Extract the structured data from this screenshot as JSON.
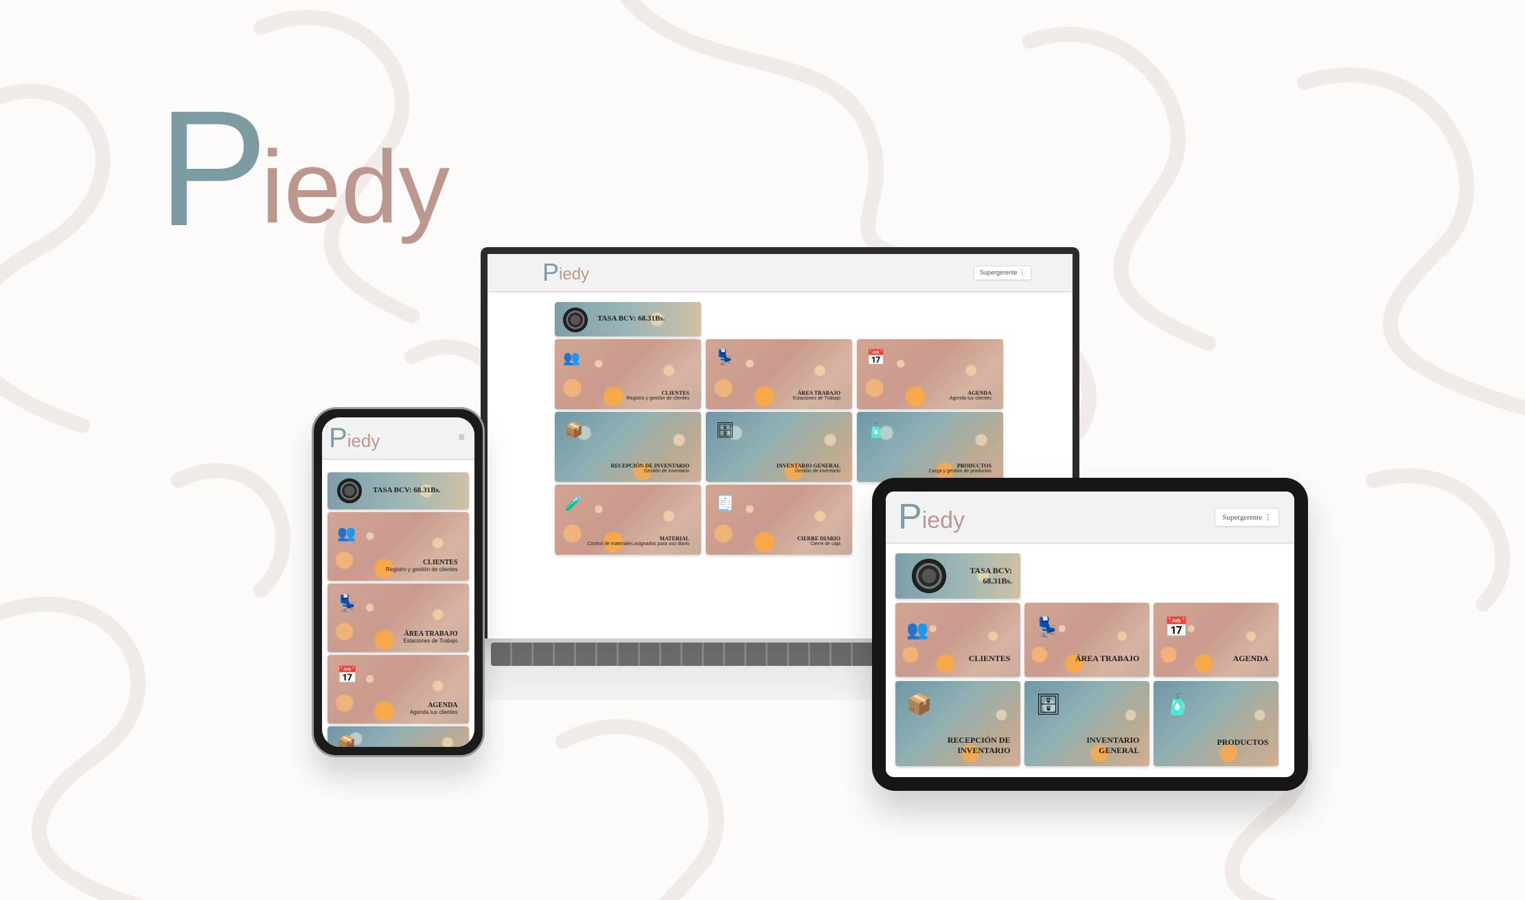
{
  "brand": {
    "logo_p": "P",
    "logo_rest": "iedy",
    "p_color": "#7c9ba3",
    "rest_color": "#bb978d"
  },
  "user_menu": {
    "label": "Supergerente",
    "icon": "kebab-menu-icon"
  },
  "rate": {
    "label": "TASA BCV: 68.31Bs.",
    "label_line1": "TASA BCV:",
    "label_line2": "68.31Bs.",
    "seal_text": "BCV"
  },
  "modules": [
    {
      "title": "CLIENTES",
      "subtitle": "Registro y gestión de clientes",
      "icon": "clients-icon"
    },
    {
      "title": "ÁREA TRABAJO",
      "subtitle": "Estaciones de Trabajo",
      "icon": "workstation-icon"
    },
    {
      "title": "AGENDA",
      "subtitle": "Agenda tus clientes",
      "icon": "calendar-icon"
    },
    {
      "title": "RECEPCIÓN DE INVENTARIO",
      "title_line1": "RECEPCIÓN DE",
      "title_line2": "INVENTARIO",
      "subtitle": "Gestión de inventario",
      "icon": "boxes-icon"
    },
    {
      "title": "INVENTARIO GENERAL",
      "title_line1": "INVENTARIO",
      "title_line2": "GENERAL",
      "subtitle": "Gestión de inventario",
      "icon": "shelves-icon"
    },
    {
      "title": "PRODUCTOS",
      "subtitle": "Carga y gestión de productos",
      "icon": "bottles-icon"
    },
    {
      "title": "MATERIAL",
      "subtitle": "Control de materiales asignados para uso diario",
      "icon": "materials-icon"
    },
    {
      "title": "CIERRE DIARIO",
      "subtitle": "Cierre de caja",
      "icon": "cash-register-icon"
    }
  ],
  "colors": {
    "header_bg": "#f3f2f2",
    "header_border": "#e9d7da",
    "warm_card": "#d2a593",
    "cool_card": "#6f97a6"
  }
}
